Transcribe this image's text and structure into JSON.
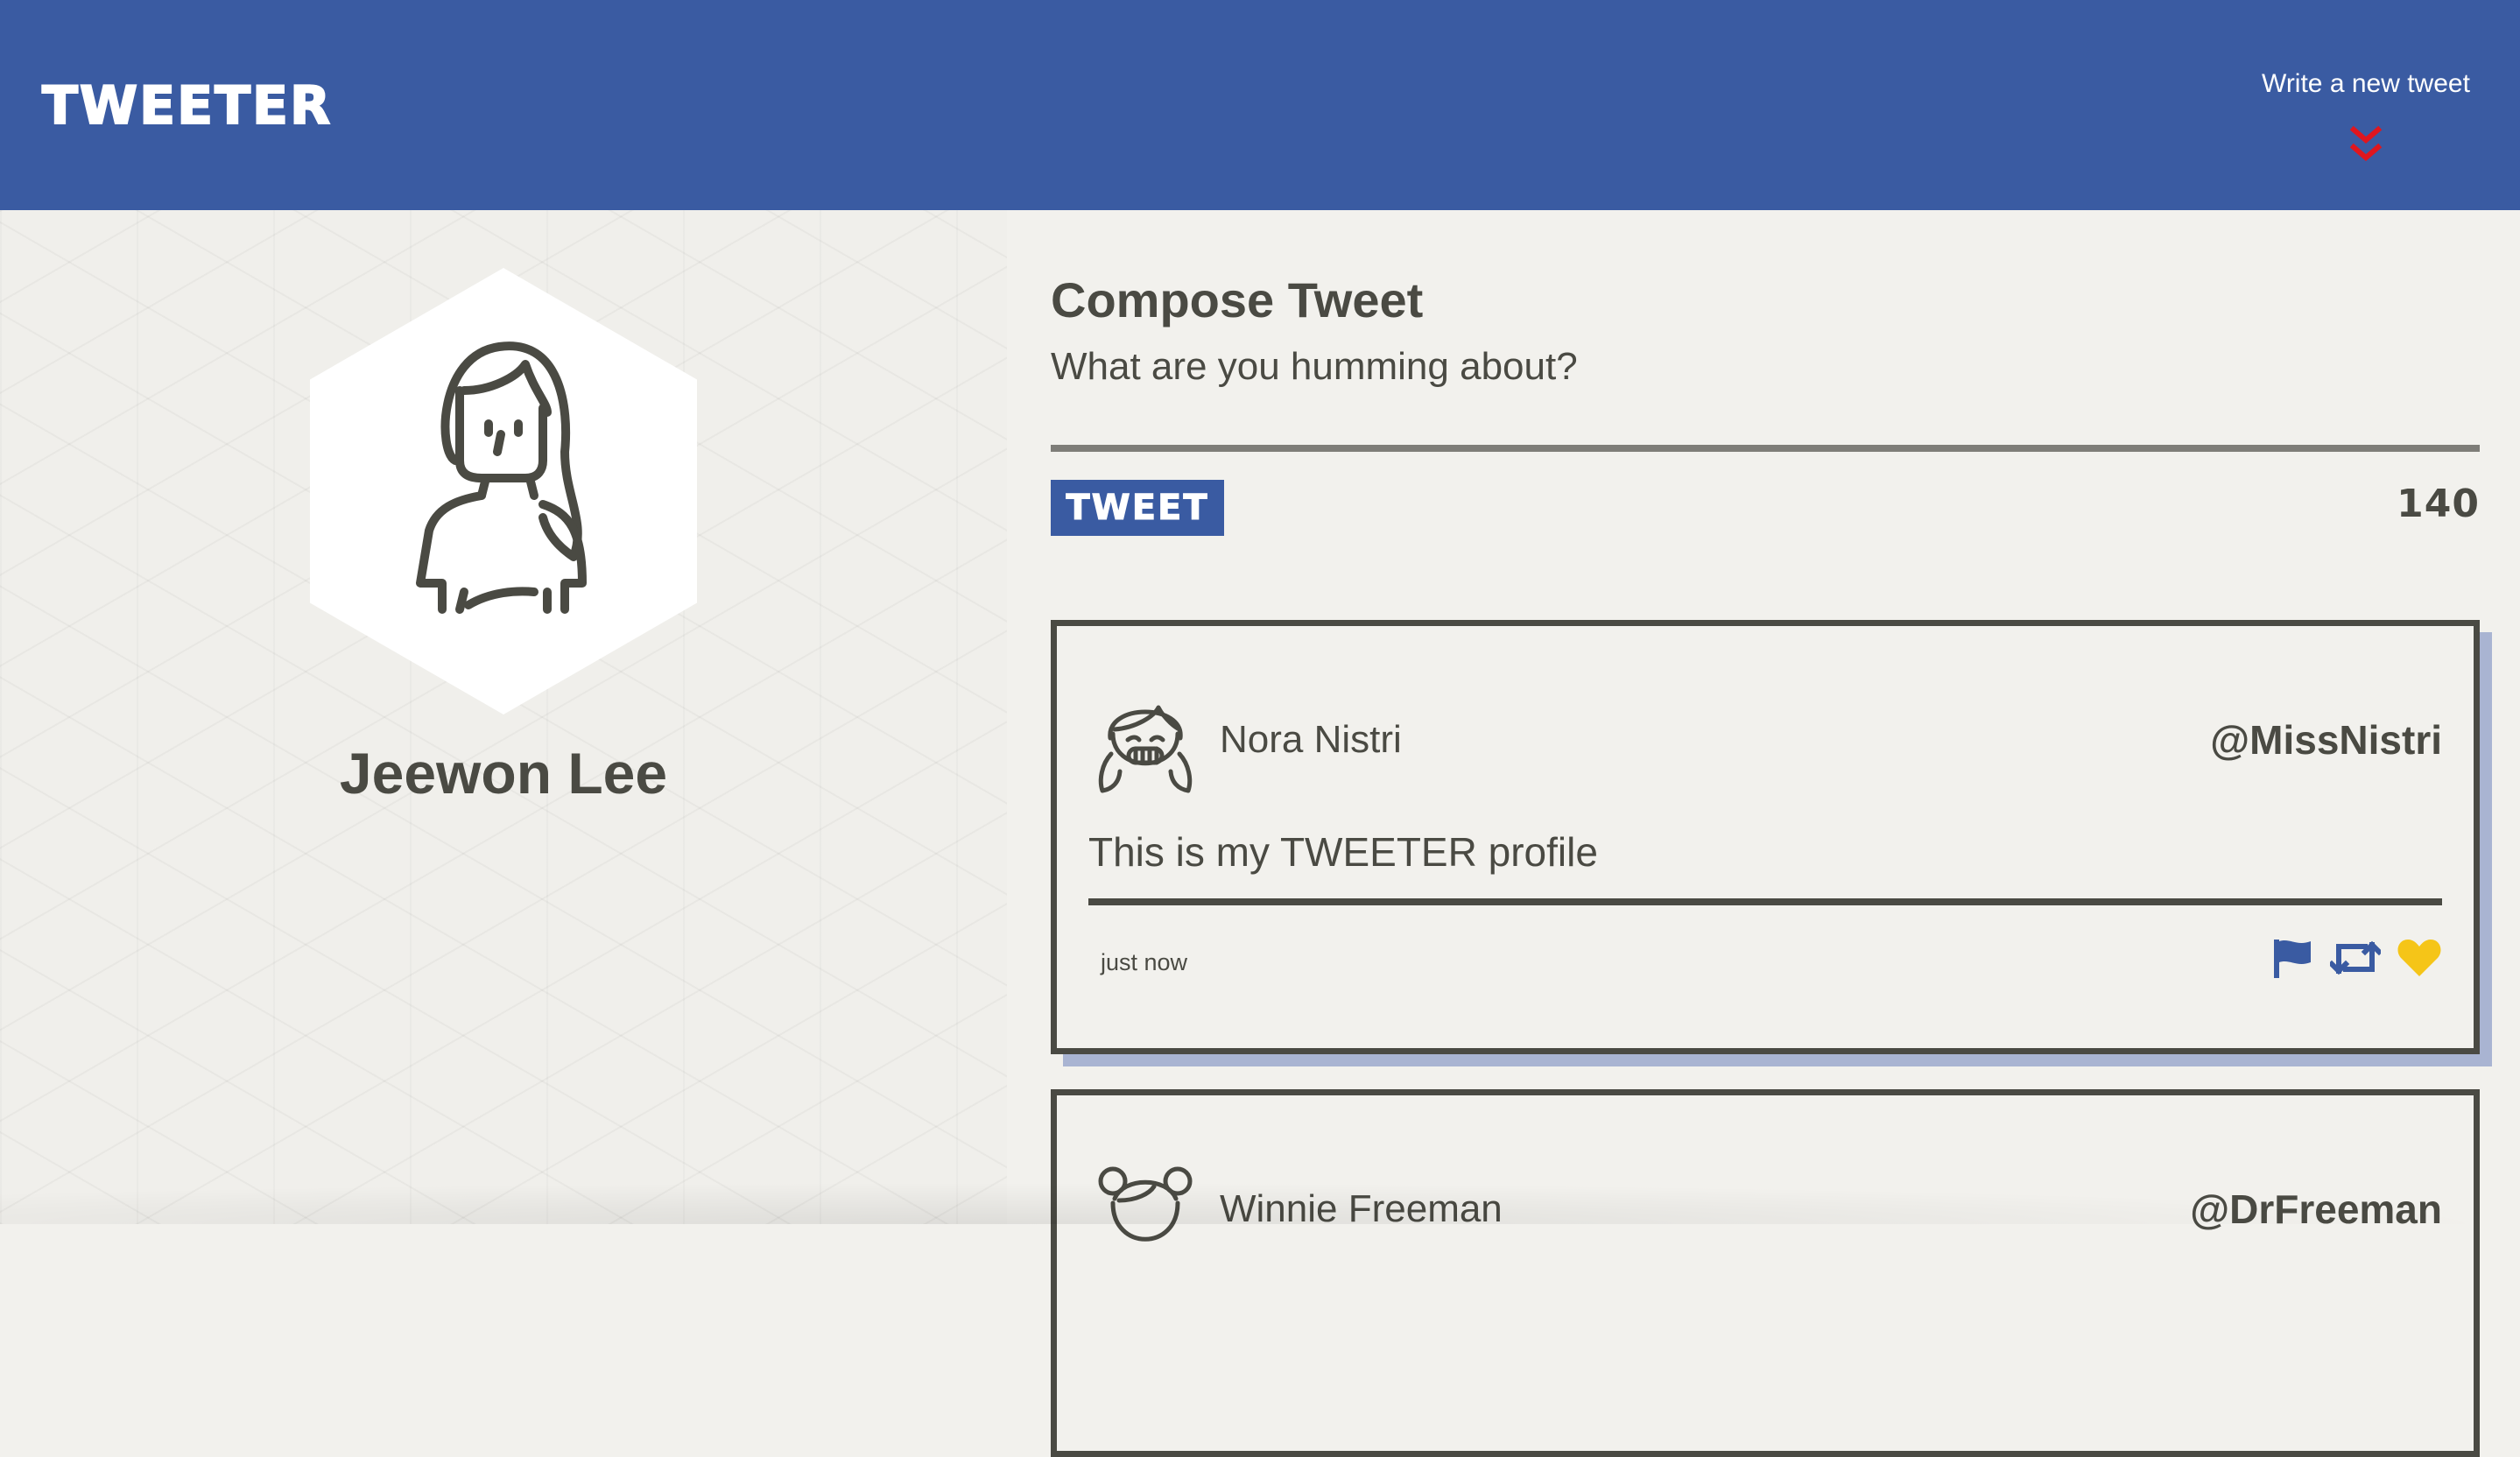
{
  "nav": {
    "brand": "TWEETER",
    "compose_toggle_label": "Write a new tweet",
    "compose_toggle_icon": "double-chevron-down-icon",
    "compose_toggle_icon_color": "#e0161e"
  },
  "colors": {
    "primary": "#3a5ba2",
    "background": "#f2f1ed",
    "text": "#4a4a43",
    "like": "#f5c518"
  },
  "profile": {
    "name": "Jeewon Lee",
    "avatar_icon": "girl-avatar-icon"
  },
  "compose": {
    "title": "Compose Tweet",
    "subtitle": "What are you humming about?",
    "input_value": "",
    "submit_label": "TWEET",
    "char_count": "140"
  },
  "tweets": [
    {
      "name": "Nora Nistri",
      "handle": "@MissNistri",
      "text": "This is my TWEETER profile",
      "time": "just now",
      "avatar_icon": "smiling-girl-avatar-icon",
      "actions": [
        "flag-icon",
        "retweet-icon",
        "heart-icon"
      ]
    },
    {
      "name": "Winnie Freeman",
      "handle": "@DrFreeman",
      "avatar_icon": "girl-buns-avatar-icon"
    }
  ]
}
